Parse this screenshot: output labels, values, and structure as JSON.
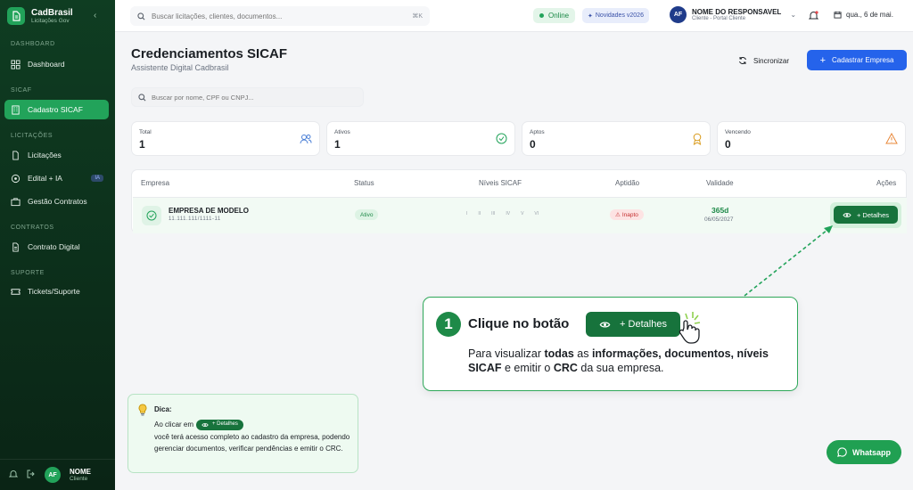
{
  "brand": {
    "name": "CadBrasil",
    "subtitle": "Licitações Gov"
  },
  "sidebar": {
    "sections": {
      "dashboard": "DASHBOARD",
      "sicaf": "SICAF",
      "licitacoes": "LICITAÇÕES",
      "contratos": "CONTRATOS",
      "suporte": "SUPORTE"
    },
    "items": {
      "dashboard": "Dashboard",
      "cadastro": "Cadastro SICAF",
      "licitacoes": "Licitações",
      "edital": "Edital + IA",
      "edital_badge": "IA",
      "gestao": "Gestão Contratos",
      "contrato": "Contrato Digital",
      "tickets": "Tickets/Suporte"
    },
    "user": {
      "initials": "AF",
      "name": "NOME",
      "role": "Cliente"
    }
  },
  "topbar": {
    "search_placeholder": "Buscar licitações, clientes, documentos...",
    "search_shortcut": "⌘K",
    "status": "Online",
    "news": "Novidades v2026",
    "user": {
      "initials": "AF",
      "name": "NOME DO RESPONSAVEL",
      "role": "Cliente - Portal Cliente"
    },
    "date": "qua., 6 de mai."
  },
  "page": {
    "title": "Credenciamentos SICAF",
    "subtitle": "Assistente Digital Cadbrasil",
    "sync_label": "Sincronizar",
    "primary_label": "Cadastrar Empresa",
    "search_placeholder": "Buscar por nome, CPF ou CNPJ..."
  },
  "stats": [
    {
      "label": "Total",
      "value": "1"
    },
    {
      "label": "Ativos",
      "value": "1"
    },
    {
      "label": "Aptos",
      "value": "0"
    },
    {
      "label": "Vencendo",
      "value": "0"
    }
  ],
  "table": {
    "headers": {
      "empresa": "Empresa",
      "status": "Status",
      "niveis": "Níveis SICAF",
      "aptidao": "Aptidão",
      "validade": "Validade",
      "acoes": "Ações"
    },
    "row": {
      "name": "EMPRESA DE MODELO",
      "cnpj": "11.111.111/1111-11",
      "status": "Ativo",
      "levels": [
        "I",
        "II",
        "III",
        "IV",
        "V",
        "VI"
      ],
      "aptidao": "Inapto",
      "days": "365d",
      "validade": "06/05/2027",
      "action": "+ Detalhes"
    }
  },
  "callout": {
    "number": "1",
    "title": "Clique no botão",
    "button": "+ Detalhes",
    "text_1": "Para visualizar ",
    "text_b1": "todas",
    "text_2": " as ",
    "text_b2": "informações, documentos, níveis SICAF",
    "text_3": " e emitir o ",
    "text_b3": "CRC",
    "text_4": " da sua empresa."
  },
  "tip": {
    "title": "Dica:",
    "pre": "Ao clicar em",
    "button": "+ Detalhes",
    "post": "você terá acesso completo ao cadastro da empresa, podendo gerenciar documentos, verificar pendências e emitir o CRC."
  },
  "whatsapp": "Whatsapp",
  "colors": {
    "brand_green": "#22a35a",
    "dark_green": "#17733c",
    "primary_blue": "#2563eb",
    "danger": "#c53030"
  }
}
